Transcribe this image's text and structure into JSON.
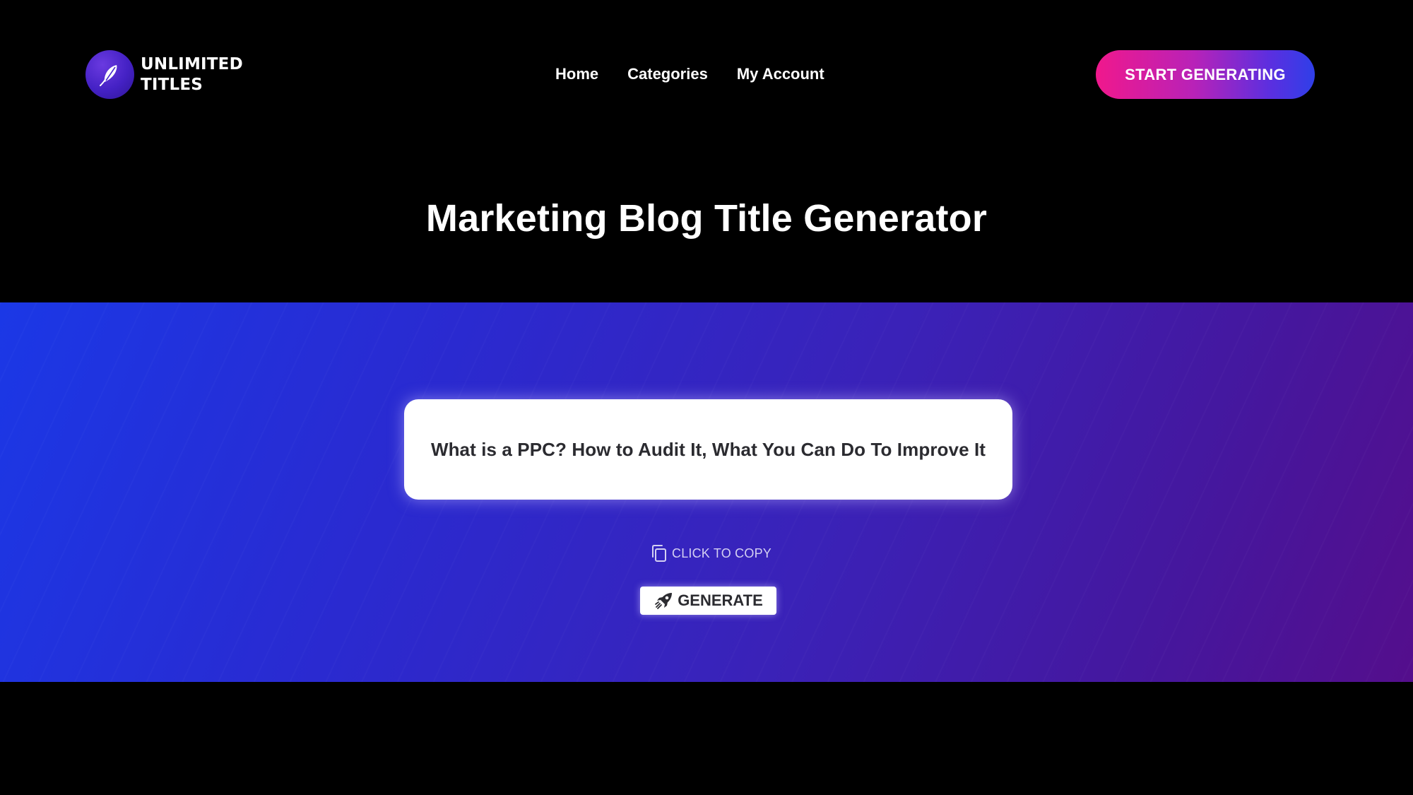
{
  "brand": {
    "name_line1": "UNLIMITED",
    "name_line2": "TITLES",
    "logo_icon": "feather-icon"
  },
  "nav": {
    "items": [
      {
        "label": "Home"
      },
      {
        "label": "Categories"
      },
      {
        "label": "My Account"
      }
    ]
  },
  "header": {
    "cta_label": "START GENERATING"
  },
  "page": {
    "title": "Marketing Blog Title Generator"
  },
  "generator": {
    "generated_title": "What is a PPC? How to Audit It, What You Can Do To Improve It",
    "copy_label": "CLICK TO COPY",
    "copy_icon": "copy-icon",
    "generate_label": "GENERATE",
    "generate_icon": "rocket-icon"
  },
  "colors": {
    "background": "#000000",
    "cta_gradient_start": "#f0188c",
    "cta_gradient_end": "#2f3fe8",
    "band_gradient_start": "#1b38e6",
    "band_gradient_end": "#540e8c",
    "card_text": "#2b2b30"
  }
}
